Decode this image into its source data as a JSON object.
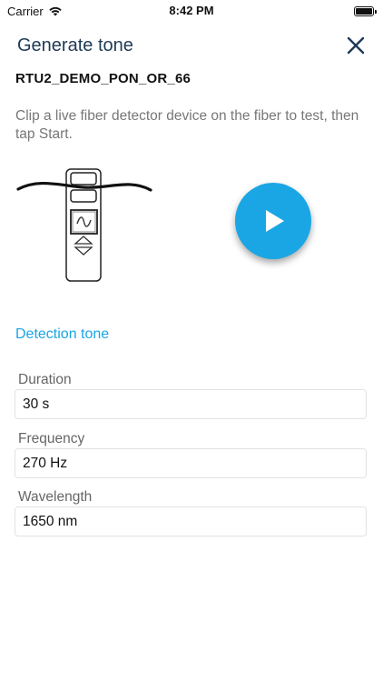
{
  "status": {
    "carrier": "Carrier",
    "time": "8:42 PM"
  },
  "header": {
    "title": "Generate tone"
  },
  "device": {
    "name": "RTU2_DEMO_PON_OR_66"
  },
  "instructions": "Clip a live fiber detector device on the fiber to test, then tap Start.",
  "section": {
    "title": "Detection tone"
  },
  "fields": {
    "duration": {
      "label": "Duration",
      "value": "30 s"
    },
    "frequency": {
      "label": "Frequency",
      "value": "270 Hz"
    },
    "wavelength": {
      "label": "Wavelength",
      "value": "1650 nm"
    }
  },
  "colors": {
    "accent": "#1aa6e4",
    "title": "#1f3a56"
  },
  "icons": [
    "wifi-icon",
    "battery-icon",
    "close-icon",
    "fiber-detector-icon",
    "play-icon"
  ]
}
